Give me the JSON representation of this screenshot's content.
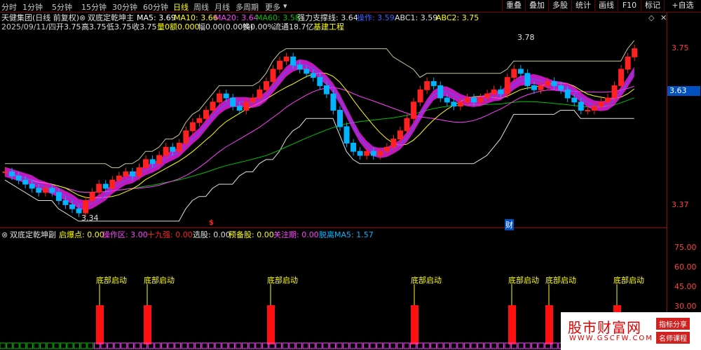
{
  "toolbar": {
    "timeframes": [
      "分时",
      "1分钟",
      "5分钟",
      "15分钟",
      "30分钟",
      "60分钟",
      "日线",
      "周线",
      "月线",
      "多周期",
      "更多"
    ],
    "active_timeframe_index": 6,
    "buttons": [
      "重叠",
      "叠加",
      "多股",
      "统计",
      "画线",
      "F10",
      "标记",
      "+自选"
    ],
    "diamond_icon": "diamond-icon",
    "close_icon": "close-icon"
  },
  "main_chart": {
    "stock_name": "天健集团(日线 前复权)",
    "indicator_name": "双底定乾坤主",
    "ma5": "MA5: 3.69",
    "ma10": "MA10: 3.66",
    "ma20": "MA20: 3.64",
    "ma60": "MA60: 3.58",
    "support": "强力支撑线: 3.64",
    "operate": "操作: 3.59",
    "abc1": "ABC1: 3.59",
    "abc2": "ABC2: 3.75",
    "date": "2025/09/11/四",
    "open": "开3.75",
    "high": "高3.75",
    "low": "低3.75",
    "close": "收3.75",
    "volume": "量0",
    "amount": "额0.000",
    "change": "幅0.00(0.00%)",
    "turnover": "换0.00%",
    "float_cap": "流通18.7亿",
    "sector": "基建工程",
    "price_labels": [
      "3.75",
      "3.37"
    ],
    "current_price": "3.63",
    "high_marker": "3.78",
    "low_marker": "3.34",
    "event_marker_left": "$",
    "event_marker_right": "财",
    "colors": {
      "up": "#ff2020",
      "down": "#00b4ff",
      "ma5": "#ffffff",
      "ma10": "#ffff00",
      "ma20": "#ff40ff",
      "ma60": "#00c000"
    }
  },
  "sub_chart": {
    "indicator_name": "双底定乾坤副",
    "start_point": "启爆点: 0.00",
    "operate_zone": "操作区: 3.00",
    "nineteen": "十九强: 0.00",
    "select": "选股: 0.00",
    "prepare": "预备股: 0.00",
    "watch": "关注期: 0.00",
    "deviate": "脱离MA5: 1.57",
    "axis_labels": [
      "75.00",
      "60.00",
      "45.00",
      "30.00"
    ],
    "signal_label": "底部启动",
    "signal_count": 8
  },
  "watermark": {
    "title": "股市财富网",
    "url": "WWW.GSCFW.COM",
    "tag1": "指标分享",
    "tag2": "名师课程"
  }
}
